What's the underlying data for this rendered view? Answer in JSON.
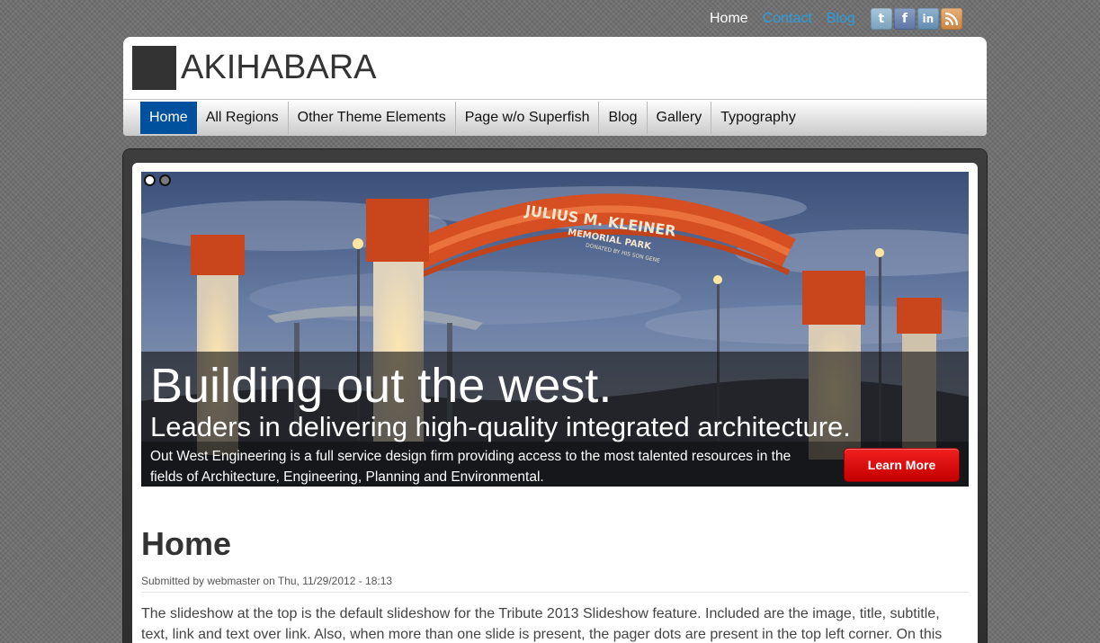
{
  "top_links": {
    "home": "Home",
    "contact": "Contact",
    "blog": "Blog"
  },
  "social_icons": [
    "twitter-icon",
    "facebook-icon",
    "linkedin-icon",
    "rss-icon"
  ],
  "site": {
    "name": "AKIHABARA"
  },
  "nav": {
    "items": [
      {
        "label": "Home",
        "active": true
      },
      {
        "label": "All Regions"
      },
      {
        "label": "Other Theme Elements"
      },
      {
        "label": "Page w/o Superfish"
      },
      {
        "label": "Blog"
      },
      {
        "label": "Gallery"
      },
      {
        "label": "Typography"
      }
    ]
  },
  "slideshow": {
    "pager": {
      "count": 2,
      "active": 1
    },
    "image_sign": {
      "line1": "JULIUS M. KLEINER",
      "line2": "MEMORIAL PARK",
      "line3": "DONATED BY HIS SON GENE"
    },
    "title": "Building out the west.",
    "subtitle": "Leaders in delivering high-quality integrated architecture.",
    "text": "Out West Engineering is a full service design firm providing access to the most talented resources in the fields of Architecture, Engineering, Planning and Environmental.",
    "link_label": "Learn More"
  },
  "article": {
    "title": "Home",
    "submitted": "Submitted by webmaster on Thu, 11/29/2012 - 18:13",
    "body": "The slideshow at the top is the default slideshow for the Tribute 2013 Slideshow feature. Included are the image, title, subtitle, text, link and text over link. Also, when more than one slide is present, the pager dots are present in the top left corner. On this page are"
  },
  "colors": {
    "nav_active": "#00519d",
    "link_blue": "#2b9de0",
    "button_red": "#e00a0a",
    "arch_orange": "#e0532a"
  }
}
